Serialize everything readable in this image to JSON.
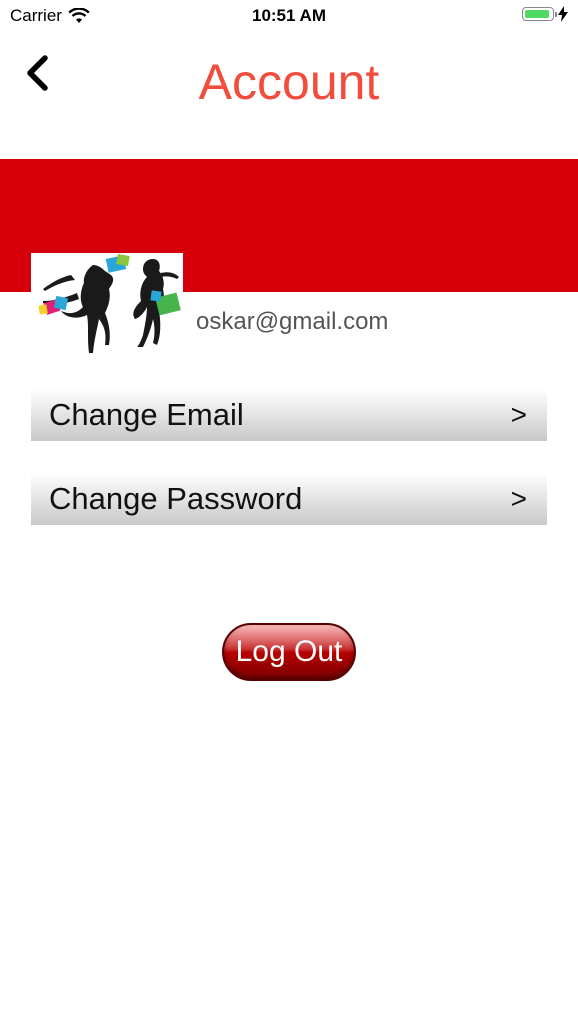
{
  "status_bar": {
    "carrier": "Carrier",
    "time": "10:51 AM",
    "icons": [
      "wifi-icon",
      "battery-icon",
      "charging-bolt-icon"
    ],
    "battery_color": "#4cd964"
  },
  "nav": {
    "title": "Account",
    "back_icon": "chevron-left-icon",
    "title_color": "#f24c3d"
  },
  "banner": {
    "color": "#d6000b"
  },
  "profile": {
    "email": "oskar@gmail.com",
    "avatar": "shopping-silhouettes-image"
  },
  "menu": [
    {
      "label": "Change Email",
      "chevron": ">"
    },
    {
      "label": "Change Password",
      "chevron": ">"
    }
  ],
  "logout": {
    "label": "Log Out",
    "color": "#b30000"
  }
}
